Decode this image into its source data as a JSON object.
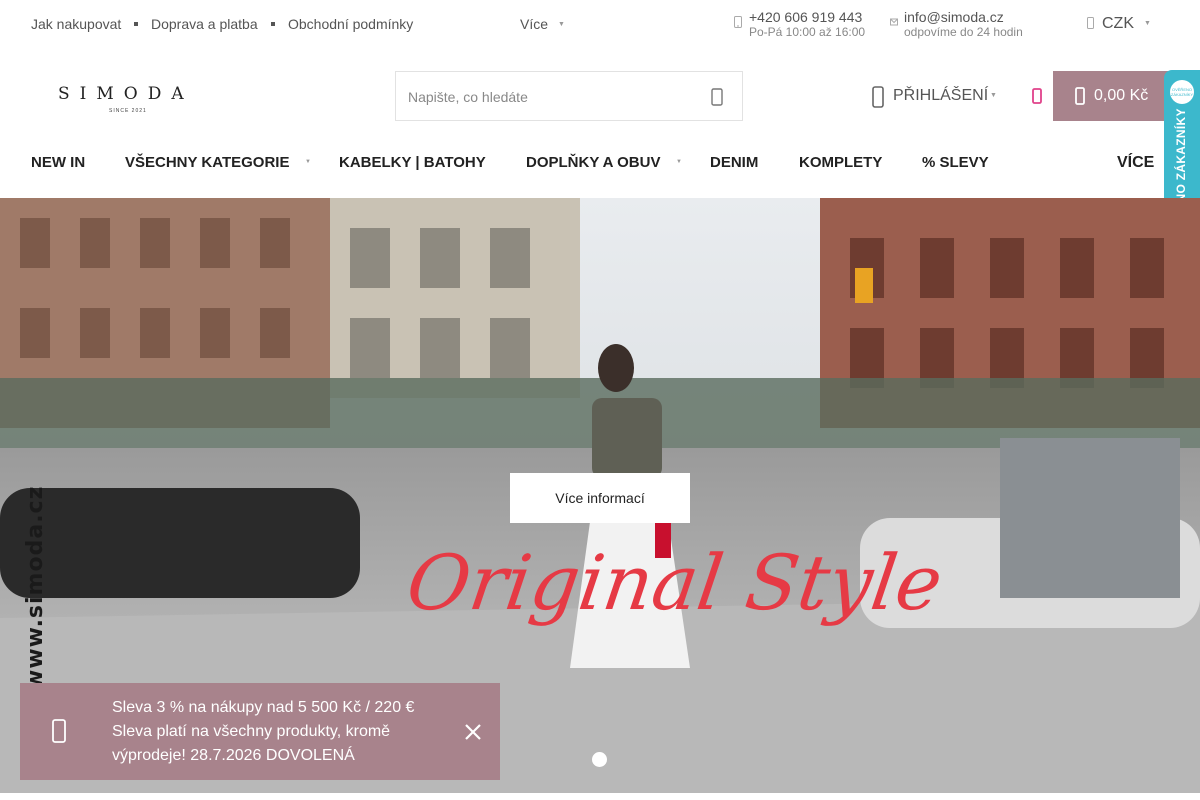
{
  "topbar": {
    "links": [
      "Jak nakupovat",
      "Doprava a platba",
      "Obchodní podmínky"
    ],
    "more_label": "Více",
    "phone": "+420 606 919 443",
    "phone_hours": "Po-Pá 10:00 až 16:00",
    "email": "info@simoda.cz",
    "email_note": "odpovíme do 24 hodin",
    "currency": "CZK"
  },
  "header": {
    "logo_text": "SIMODA",
    "logo_since": "SINCE 2021",
    "search_placeholder": "Napište, co hledáte",
    "login_label": "PŘIHLÁŠENÍ",
    "cart_total": "0,00 Kč"
  },
  "nav": {
    "items": [
      "NEW IN",
      "VŠECHNY KATEGORIE",
      "KABELKY | BATOHY",
      "DOPLŇKY A OBUV",
      "DENIM",
      "KOMPLETY",
      "% SLEVY"
    ],
    "more_label": "VÍCE"
  },
  "badge": {
    "text": "OVĚŘENO ZÁKAZNÍKY",
    "seal": "OVĚŘENO ZÁKAZNÍKY"
  },
  "hero": {
    "button_label": "Více informací",
    "title": "Original Style",
    "watermark": "www.simoda.cz",
    "slide_count": 1,
    "active_slide": 1
  },
  "promo": {
    "line1": "Sleva 3 % na nákupy nad 5 500 Kč / 220 €",
    "line2": "Sleva platí na všechny produkty, kromě výprodeje! 28.7.2026 DOVOLENÁ"
  },
  "colors": {
    "accent": "#a8838c",
    "badge": "#3cb8cc",
    "hero_title": "#e63a45",
    "favorite": "#e0428a"
  },
  "icons": {
    "phone": "phone-icon",
    "email": "email-icon",
    "currency": "chevron-down-icon",
    "search": "search-icon",
    "login": "user-icon",
    "favorite": "heart-icon",
    "cart": "cart-icon",
    "promo": "gift-icon",
    "close": "close-icon"
  }
}
